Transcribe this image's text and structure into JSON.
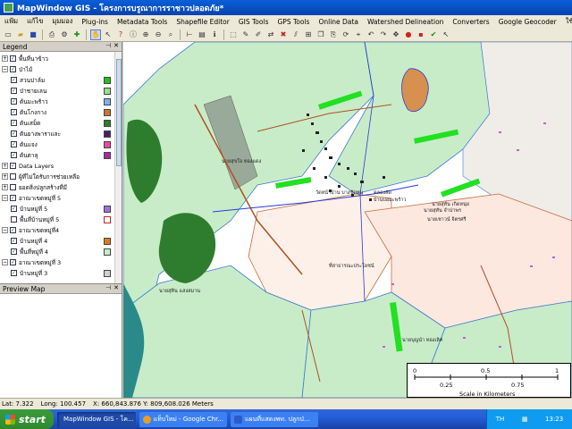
{
  "window": {
    "title": "MapWindow GIS  - โครงการบรูณาการราชาวปลอดภัย*"
  },
  "menu": [
    "แฟ้ม",
    "แก้ไข",
    "มุมมอง",
    "Plug-ins",
    "Metadata Tools",
    "Shapefile Editor",
    "GIS Tools",
    "GPS Tools",
    "Online Data",
    "Watershed Delineation",
    "Converters",
    "Google Geocoder",
    "ใช้ช่"
  ],
  "legend": {
    "header": "Legend",
    "rows": [
      {
        "label": "พื้นที่นาข้าว",
        "indent": 0,
        "expander": "+",
        "checked": true,
        "swatch": null
      },
      {
        "label": "ป่าไม้",
        "indent": 0,
        "expander": "−",
        "checked": true,
        "swatch": null
      },
      {
        "label": "สวนปาล์ม",
        "indent": 1,
        "expander": "",
        "checked": true,
        "swatch": "#22c022"
      },
      {
        "label": "ป่าชายเลน",
        "indent": 1,
        "expander": "",
        "checked": true,
        "swatch": "#8ee08e"
      },
      {
        "label": "ต้นมะพร้าว",
        "indent": 1,
        "expander": "",
        "checked": true,
        "swatch": "#7fb0f0"
      },
      {
        "label": "ต้นโกงกาง",
        "indent": 1,
        "expander": "",
        "checked": true,
        "swatch": "#c87830"
      },
      {
        "label": "ต้นเสม็ด",
        "indent": 1,
        "expander": "",
        "checked": true,
        "swatch": "#2e7d2e"
      },
      {
        "label": "ต้นยางพาราและ",
        "indent": 1,
        "expander": "",
        "checked": true,
        "swatch": "#4a1e6a"
      },
      {
        "label": "ต้นแจง",
        "indent": 1,
        "expander": "",
        "checked": true,
        "swatch": "#e84aa0"
      },
      {
        "label": "ต้นตาลุ",
        "indent": 1,
        "expander": "",
        "checked": true,
        "swatch": "#a82aa0"
      },
      {
        "label": "Data Layers",
        "indent": 0,
        "expander": "+",
        "checked": true,
        "swatch": null
      },
      {
        "label": "ผู้ที่ไม่ใดรับการช่วยเหลือ",
        "indent": 0,
        "expander": "+",
        "checked": false,
        "swatch": null
      },
      {
        "label": "ยอดสิ่งปลูกสร้างที่มี",
        "indent": 0,
        "expander": "+",
        "checked": false,
        "swatch": null
      },
      {
        "label": "อาณาเขตหมู่ที่ 5",
        "indent": 0,
        "expander": "−",
        "checked": true,
        "swatch": null
      },
      {
        "label": "บ้านหมู่ที่ 5",
        "indent": 1,
        "expander": "",
        "checked": true,
        "swatch": "#a070e0"
      },
      {
        "label": "พื้นที่บ้านหมู่ที่ 5",
        "indent": 1,
        "expander": "",
        "checked": false,
        "swatch": "#ffffff"
      },
      {
        "label": "อาณาเขตหมู่ที่4",
        "indent": 0,
        "expander": "−",
        "checked": true,
        "swatch": null
      },
      {
        "label": "บ้านหมู่ที่ 4",
        "indent": 1,
        "expander": "",
        "checked": true,
        "swatch": "#e07820"
      },
      {
        "label": "พื้นที่หมู่ที่ 4",
        "indent": 1,
        "expander": "",
        "checked": true,
        "swatch": "#c8ecc8"
      },
      {
        "label": "อาณาเขตหมู่ที่ 3",
        "indent": 0,
        "expander": "−",
        "checked": true,
        "swatch": null
      },
      {
        "label": "บ้านหมู่ที่ 3",
        "indent": 1,
        "expander": "",
        "checked": true,
        "swatch": "#d0d0d0"
      }
    ]
  },
  "preview": {
    "header": "Preview Map"
  },
  "map": {
    "labels": [
      "วัดหน้าบ้าน บางซัดทุน",
      "บ้านบ่อมะพร้าว",
      "นายสุทัน เกิดหนุ่ย",
      "คลองลัด",
      "นายสุทัน จำปาพร",
      "นายเชาวน์ จิตรศรี",
      "นายสุขใจ ทองแดง",
      "นายสุทิน แสงสมาน",
      "นายบุญนำ ทองเลิศ",
      "ที่สาธารณะประโยชน์"
    ],
    "scale": {
      "ticks": [
        "0",
        "0.25",
        "0.5",
        "0.75",
        "1"
      ],
      "caption": "Scale in Kilometers"
    }
  },
  "status": {
    "lat": "Lat: 7.322",
    "long": "Long: 100.457",
    "xy": "X: 660,843.876   Y: 809,608.026 Meters"
  },
  "taskbar": {
    "start": "start",
    "tasks": [
      {
        "label": "MapWindow GIS - โค...",
        "active": true,
        "icon": "#4aa04a"
      },
      {
        "label": "แท็บใหม่ - Google Chr...",
        "active": false,
        "icon": "#e8a020"
      },
      {
        "label": "แผนที่แสดงพท. ปลูกป่...",
        "active": false,
        "icon": "#2a5cc8"
      }
    ],
    "lang": "TH",
    "time": "13:23"
  }
}
